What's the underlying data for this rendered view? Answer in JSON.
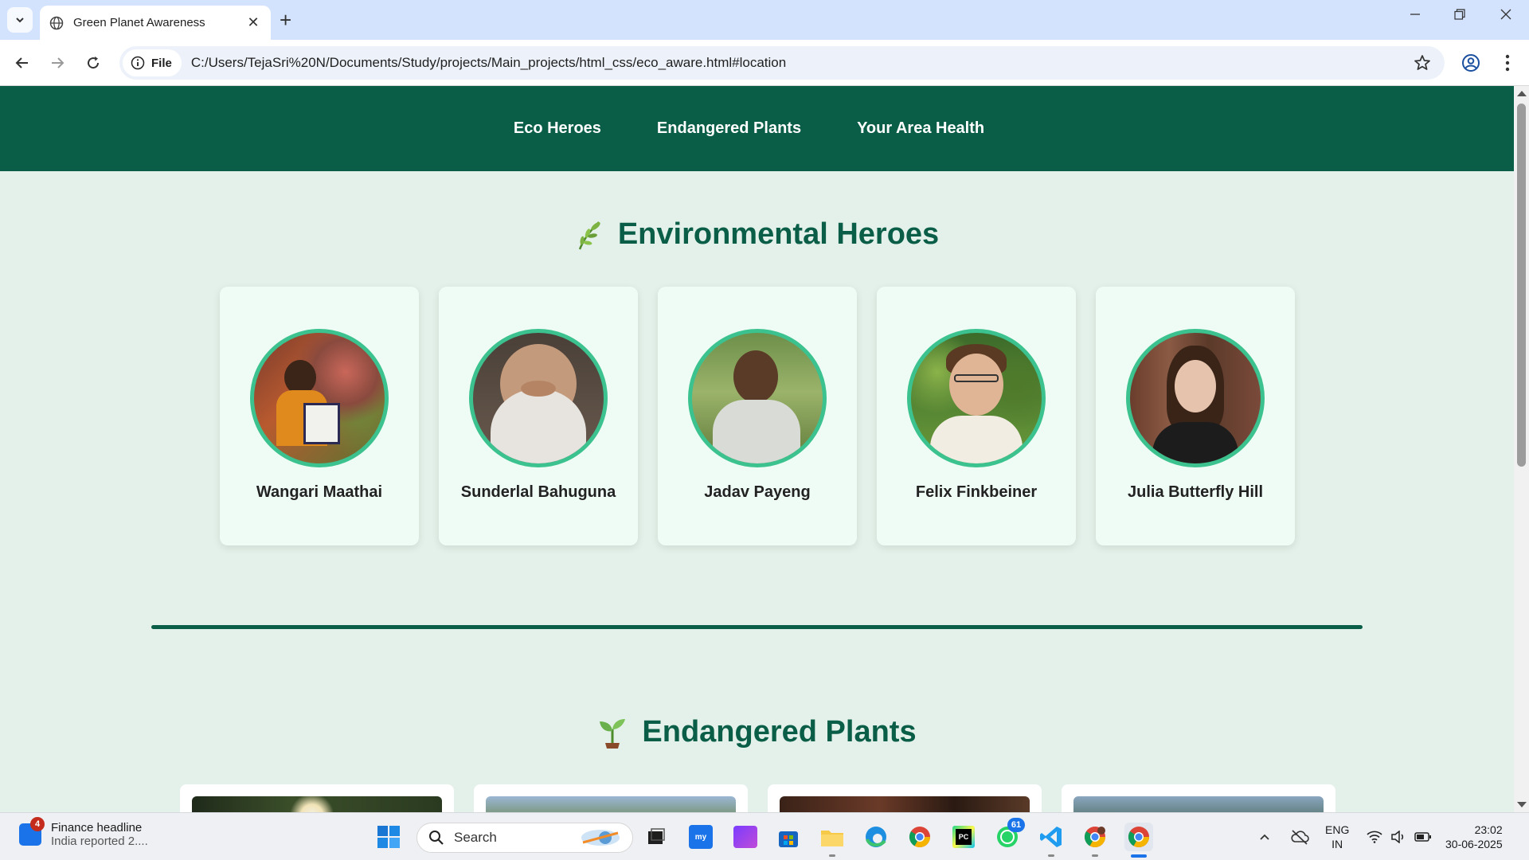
{
  "browser": {
    "tab_title": "Green Planet Awareness",
    "new_tab": "+",
    "close_tab": "✕",
    "site_chip": "File",
    "url": "C:/Users/TejaSri%20N/Documents/Study/projects/Main_projects/html_css/eco_aware.html#location"
  },
  "site_nav": {
    "items": [
      "Eco Heroes",
      "Endangered Plants",
      "Your Area Health"
    ]
  },
  "heroes": {
    "title": "Environmental Heroes",
    "icon": "herb-icon",
    "people": [
      {
        "name": "Wangari Maathai"
      },
      {
        "name": "Sunderlal Bahuguna"
      },
      {
        "name": "Jadav Payeng"
      },
      {
        "name": "Felix Finkbeiner"
      },
      {
        "name": "Julia Butterfly Hill"
      }
    ]
  },
  "plants": {
    "title": "Endangered Plants",
    "icon": "seedling-icon"
  },
  "taskbar": {
    "news_badge": "4",
    "news_title": "Finance headline",
    "news_sub": "India reported 2....",
    "search_label": "Search",
    "whatsapp_badge": "61",
    "lang_top": "ENG",
    "lang_bottom": "IN",
    "time": "23:02",
    "date": "30-06-2025"
  },
  "colors": {
    "nav_bg": "#0a5e47",
    "page_bg": "#e4f1ea",
    "card_bg": "#effcf5",
    "avatar_ring": "#3cc28f"
  }
}
